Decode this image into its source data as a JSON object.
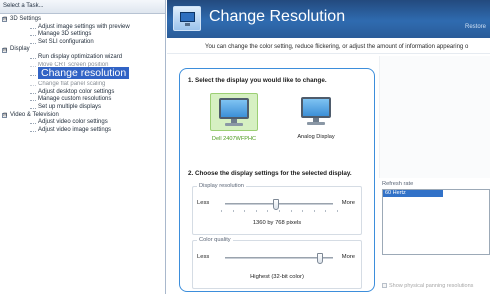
{
  "sidebar": {
    "header": "Select a Task...",
    "tree": [
      {
        "type": "cat",
        "label": "3D Settings",
        "expander": "⊟"
      },
      {
        "type": "leaf",
        "label": "Adjust image settings with preview"
      },
      {
        "type": "leaf",
        "label": "Manage 3D settings"
      },
      {
        "type": "leaf",
        "label": "Set SLI configuration"
      },
      {
        "type": "cat",
        "label": "Display",
        "expander": "⊟"
      },
      {
        "type": "leaf",
        "label": "Run display optimization wizard"
      },
      {
        "type": "leaf",
        "label": "Move CRT screen position",
        "half": true
      },
      {
        "type": "leaf",
        "label": "Change resolution",
        "selected": true
      },
      {
        "type": "leaf",
        "label": "Change flat panel scaling",
        "half": true
      },
      {
        "type": "leaf",
        "label": "Adjust desktop color settings"
      },
      {
        "type": "leaf",
        "label": "Manage custom resolutions"
      },
      {
        "type": "leaf",
        "label": "Set up multiple displays"
      },
      {
        "type": "cat",
        "label": "Video & Television",
        "expander": "⊟"
      },
      {
        "type": "leaf",
        "label": "Adjust video color settings"
      },
      {
        "type": "leaf",
        "label": "Adjust video image settings"
      }
    ]
  },
  "header": {
    "title": "Change Resolution",
    "restore": "Restore",
    "description": "You can change the color setting, reduce flickering, or adjust the amount of information appearing o"
  },
  "step1": {
    "label": "1. Select the display you would like to change.",
    "displays": [
      {
        "name": "Dell 2407WFPHC",
        "selected": true
      },
      {
        "name": "Analog Display",
        "selected": false
      }
    ]
  },
  "step2": {
    "label": "2. Choose the display settings for the selected display.",
    "resolution": {
      "title": "Display resolution",
      "less": "Less",
      "more": "More",
      "value": "1360 by 768 pixels",
      "position": 0.47
    },
    "color_quality": {
      "title": "Color quality",
      "less": "Less",
      "more": "More",
      "value": "Highest (32-bit color)",
      "position": 0.88
    }
  },
  "refresh": {
    "label": "Refresh rate",
    "options": [
      "60 Hertz"
    ],
    "selected": "60 Hertz"
  },
  "panning": {
    "label": "Show physical panning resolutions"
  },
  "colors": {
    "accent": "#3163c5",
    "panel_border": "#3d8edb",
    "selected_display_text": "#4c9a1d"
  }
}
